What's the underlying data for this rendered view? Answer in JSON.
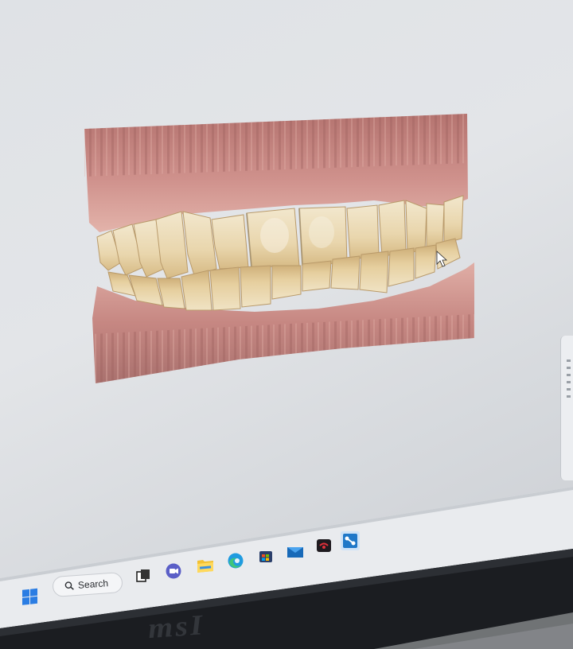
{
  "taskbar": {
    "search_label": "Search",
    "icons": [
      "windows-start-icon",
      "search-icon",
      "task-view-icon",
      "chat-icon",
      "file-explorer-icon",
      "edge-browser-icon",
      "store-icon",
      "mail-icon",
      "media-app-icon",
      "scan-app-icon"
    ]
  },
  "hardware": {
    "brand_text": "msI"
  },
  "viewer": {
    "model": "dental-arch-3d-scan"
  },
  "colors": {
    "screen": "#e0e3e6",
    "taskbar": "#e9ebee",
    "bezel": "#1b1d21",
    "gum": "#c98a86",
    "tooth": "#ecdcb8"
  }
}
